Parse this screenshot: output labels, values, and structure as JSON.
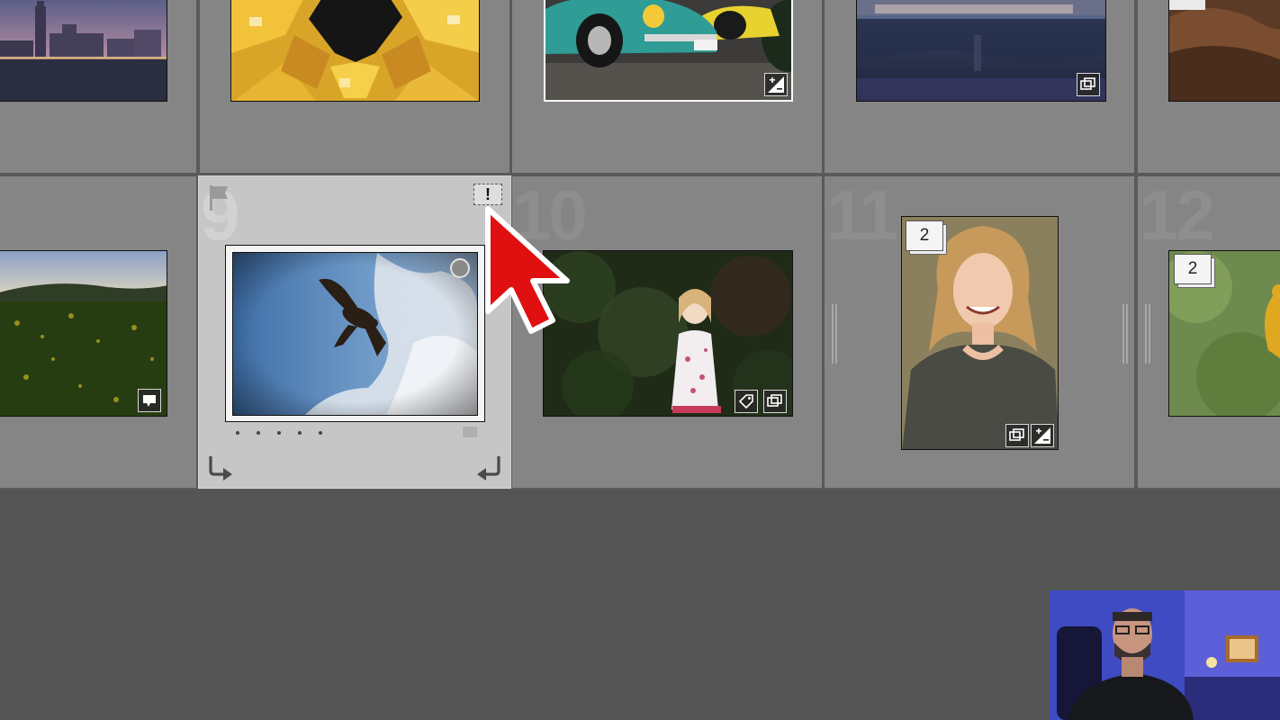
{
  "grid": {
    "rows": [
      {
        "cells": [
          {
            "scene": "harbor-skyline-at-dusk"
          },
          {
            "scene": "yellow-cube-houses"
          },
          {
            "scene": "teal-vintage-beetle"
          },
          {
            "scene": "lake-town-reflection"
          },
          {
            "scene": "rocky-landscape"
          }
        ]
      },
      {
        "cells": [
          {
            "scene": "rapeseed-field"
          },
          {
            "index": "9",
            "scene": "bird-of-prey-in-sky",
            "selected": true,
            "rating_dots": 5
          },
          {
            "index": "10",
            "scene": "little-girl-in-garden"
          },
          {
            "index": "11",
            "scene": "smiling-woman-portrait",
            "stack_count": "2"
          },
          {
            "index": "12",
            "scene": "bird-on-branch",
            "stack_count": "2"
          }
        ]
      }
    ],
    "selected_controls": {
      "quick_collection_mark": "!"
    }
  },
  "icons": {
    "flag": "flag-icon",
    "rotate_left": "rotate-left-icon",
    "rotate_right": "rotate-right-icon",
    "circle": "quick-collection-circle-icon",
    "develop": "develop-adjustments-icon",
    "crop": "crop-icon",
    "comment": "comment-icon",
    "keyword": "keyword-tag-icon",
    "pointer": "red-pointer-icon"
  },
  "colors": {
    "pointer": "#e01010",
    "selected_cell": "#c6c6c6",
    "cell": "#858585",
    "background": "#545454"
  }
}
